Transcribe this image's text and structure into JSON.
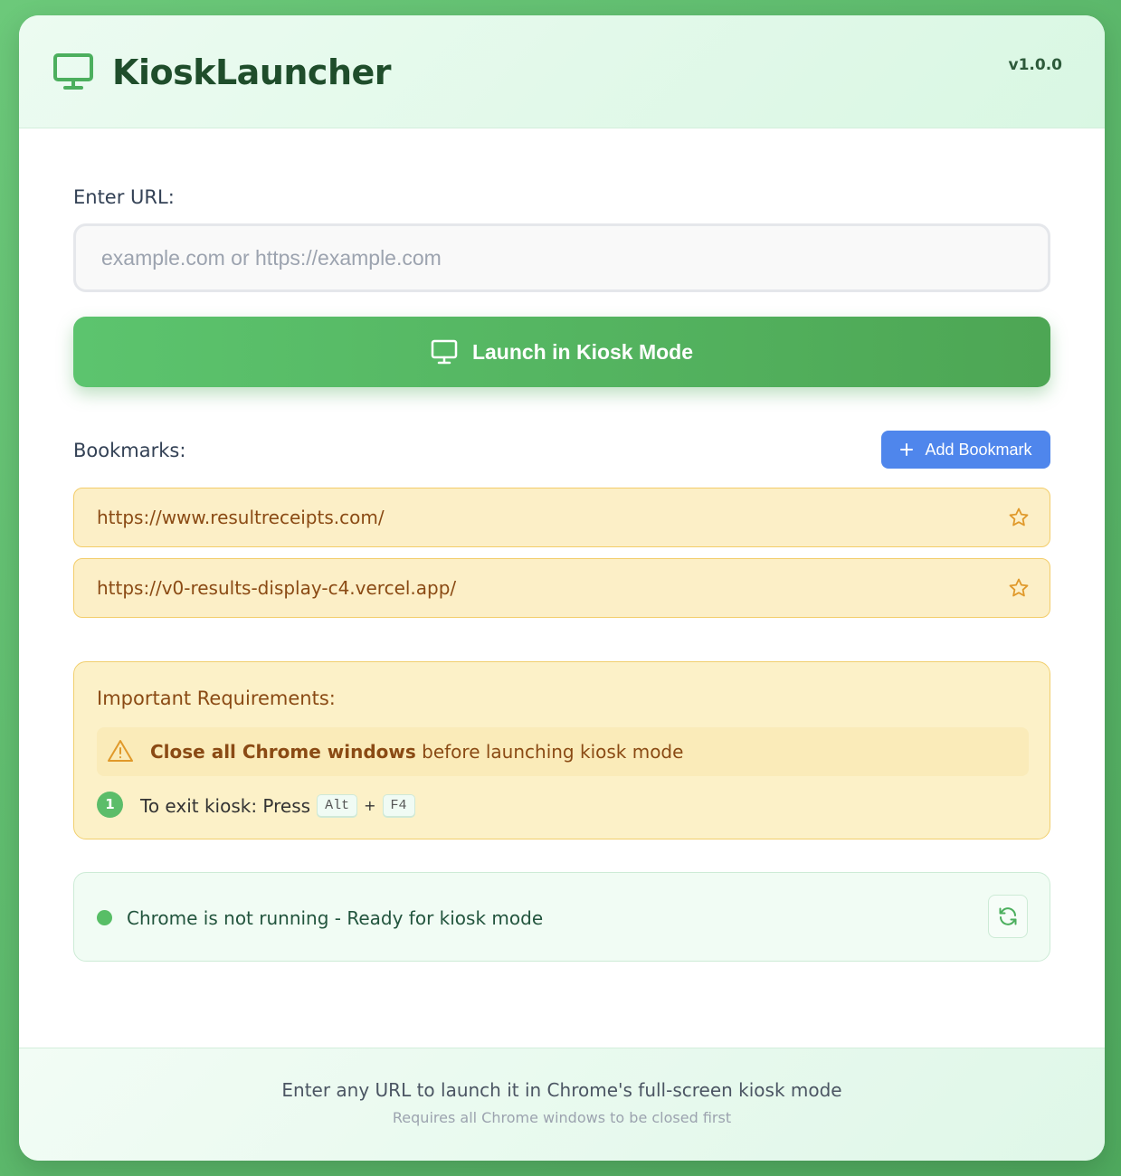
{
  "header": {
    "app_title": "KioskLauncher",
    "version": "v1.0.0",
    "logo_icon": "monitor-icon"
  },
  "url_form": {
    "label": "Enter URL:",
    "input_value": "",
    "input_placeholder": "example.com or https://example.com",
    "launch_label": "Launch in Kiosk Mode",
    "launch_icon": "monitor-icon"
  },
  "bookmarks": {
    "label": "Bookmarks:",
    "add_label": "Add Bookmark",
    "add_icon": "plus-icon",
    "items": [
      {
        "url": "https://www.resultreceipts.com/",
        "icon": "star-icon"
      },
      {
        "url": "https://v0-results-display-c4.vercel.app/",
        "icon": "star-icon"
      }
    ]
  },
  "requirements": {
    "title": "Important Requirements:",
    "warning_bold": "Close all Chrome windows",
    "warning_rest": " before launching kiosk mode",
    "warning_icon": "warning-triangle-icon",
    "step_number": "1",
    "step_text": "To exit kiosk: Press",
    "key_1": "Alt",
    "key_plus": "+",
    "key_2": "F4"
  },
  "status": {
    "text": "Chrome is not running - Ready for kiosk mode",
    "dot_color": "#58be66",
    "refresh_icon": "refresh-icon"
  },
  "footer": {
    "main": "Enter any URL to launch it in Chrome's full-screen kiosk mode",
    "sub": "Requires all Chrome windows to be closed first"
  },
  "colors": {
    "accent_green": "#5cc46e",
    "accent_blue": "#4f86ec",
    "bookmark_bg": "#fcefc7",
    "bookmark_text": "#8a4a14"
  }
}
